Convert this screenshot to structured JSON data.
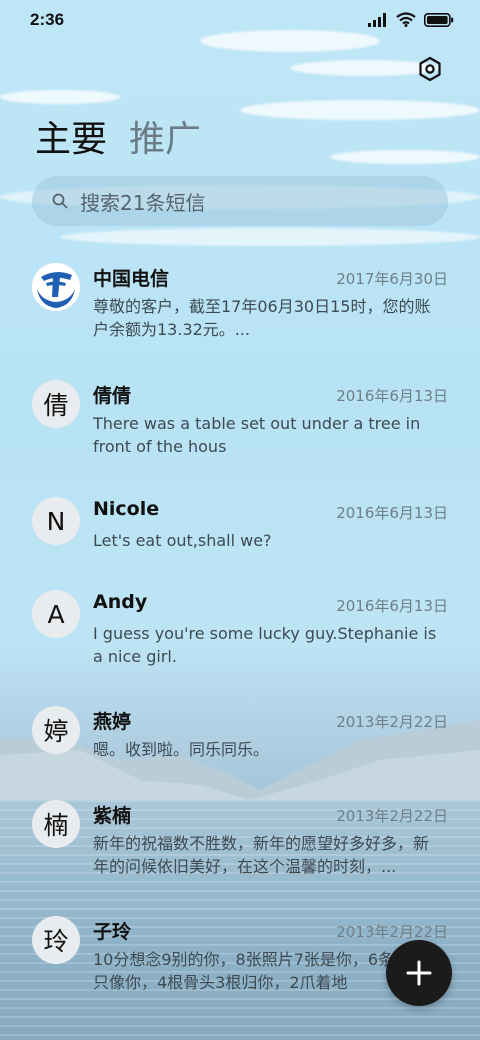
{
  "status": {
    "time": "2:36"
  },
  "tabs": [
    {
      "label": "主要"
    },
    {
      "label": "推广"
    }
  ],
  "search": {
    "placeholder": "搜索21条短信"
  },
  "conversations": [
    {
      "avatar": "",
      "avatar_icon": "china-telecom-logo",
      "name": "中国电信",
      "date": "2017年6月30日",
      "preview": "尊敬的客户，截至17年06月30日15时，您的账户余额为13.32元。..."
    },
    {
      "avatar": "倩",
      "name": "倩倩",
      "date": "2016年6月13日",
      "preview": "There was a table set out under a tree in front of the hous"
    },
    {
      "avatar": "N",
      "name": "Nicole",
      "date": "2016年6月13日",
      "preview": "Let's eat out,shall we?"
    },
    {
      "avatar": "A",
      "name": "Andy",
      "date": "2016年6月13日",
      "preview": "I guess you're some lucky guy.Stephanie is a nice girl."
    },
    {
      "avatar": "婷",
      "name": "燕婷",
      "date": "2013年2月22日",
      "preview": "嗯。收到啦。同乐同乐。"
    },
    {
      "avatar": "楠",
      "name": "紫楠",
      "date": "2013年2月22日",
      "preview": "新年的祝福数不胜数，新年的愿望好多好多，新年的问候依旧美好，在这个温馨的时刻，..."
    },
    {
      "avatar": "玲",
      "name": "子玲",
      "date": "2013年2月22日",
      "preview": "10分想念9别的你，8张照片7张是你，6条小狗5只像你，4根骨头3根归你，2爪着地"
    }
  ],
  "colors": {
    "accent": "#1b1b1b",
    "telecom_blue": "#1f5fb4"
  },
  "icons": {
    "settings": "settings-icon",
    "search": "search-icon",
    "compose": "plus-icon"
  }
}
